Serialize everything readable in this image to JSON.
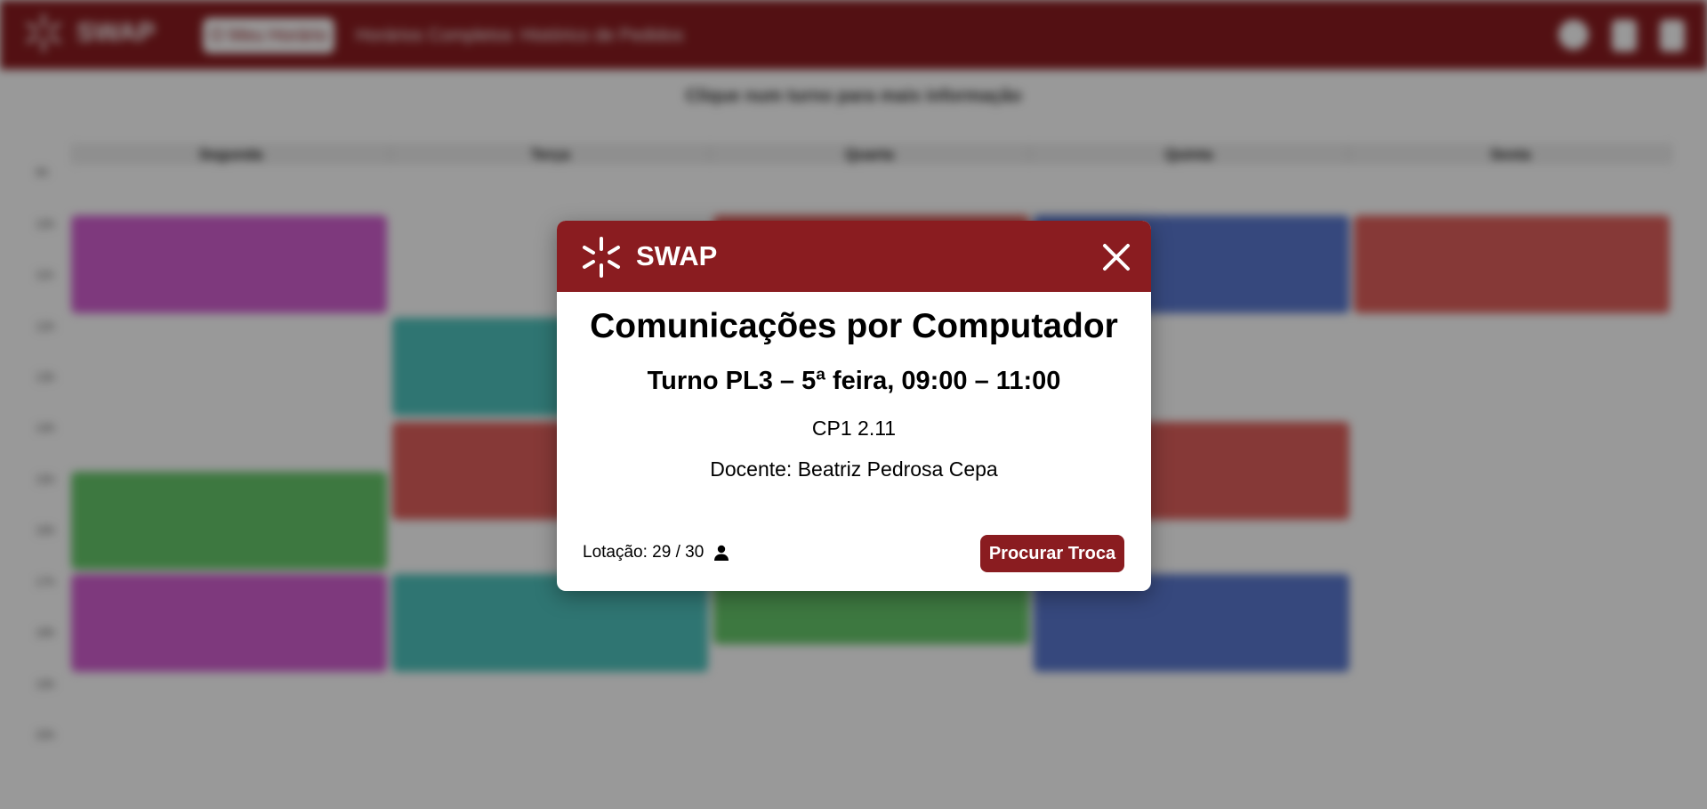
{
  "app": {
    "brand": "SWAP"
  },
  "background": {
    "nav": [
      "O Meu Horário",
      "Horários Completos",
      "Histórico de Pedidos"
    ],
    "hint": "Clique num turno para mais informação",
    "days": [
      "Segunda",
      "Terça",
      "Quarta",
      "Quinta",
      "Sexta"
    ],
    "hours": [
      "9h",
      "10h",
      "11h",
      "12h",
      "13h",
      "14h",
      "15h",
      "16h",
      "17h",
      "18h",
      "19h",
      "20h"
    ]
  },
  "modal": {
    "brand": "SWAP",
    "title": "Comunicações por Computador",
    "turno": "Turno PL3 – 5ª feira, 09:00 – 11:00",
    "room": "CP1 2.11",
    "docente": "Docente: Beatriz Pedrosa Cepa",
    "lotacao": "Lotação: 29 / 30",
    "action_label": "Procurar Troca",
    "icons": {
      "logo": "university-star-logo-icon",
      "close": "close-icon",
      "capacity": "person-icon"
    }
  },
  "colors": {
    "brand": "#8a1c20",
    "magenta": "#d25fd0",
    "teal": "#4fc4be",
    "red": "#e0605c",
    "green": "#67c96b",
    "blue": "#5b79d0"
  }
}
